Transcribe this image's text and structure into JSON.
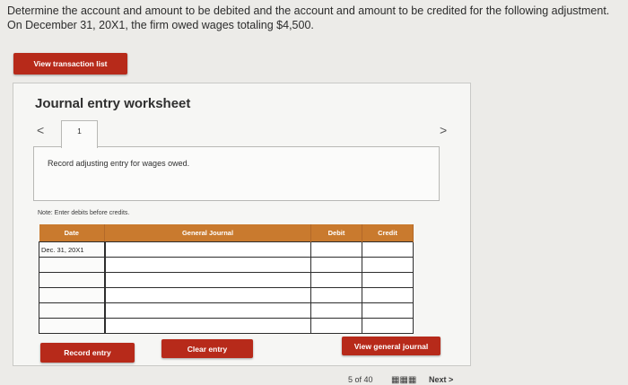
{
  "question": {
    "text": "Determine the account and amount to be debited and the account and amount to be credited for the following adjustment. On December 31, 20X1, the firm owed wages totaling $4,500."
  },
  "buttons": {
    "view_transaction_list": "View transaction list",
    "record_entry": "Record entry",
    "clear_entry": "Clear entry",
    "view_general_journal": "View general journal"
  },
  "worksheet": {
    "title": "Journal entry worksheet",
    "nav_prev": "<",
    "nav_next": ">",
    "current_tab": "1",
    "instruction": "Record adjusting entry for wages owed.",
    "note": "Note: Enter debits before credits."
  },
  "journal_table": {
    "headers": {
      "date": "Date",
      "general_journal": "General Journal",
      "debit": "Debit",
      "credit": "Credit"
    },
    "rows": [
      {
        "date": "Dec. 31, 20X1",
        "account": "",
        "debit": "",
        "credit": ""
      },
      {
        "date": "",
        "account": "",
        "debit": "",
        "credit": ""
      },
      {
        "date": "",
        "account": "",
        "debit": "",
        "credit": ""
      },
      {
        "date": "",
        "account": "",
        "debit": "",
        "credit": ""
      },
      {
        "date": "",
        "account": "",
        "debit": "",
        "credit": ""
      },
      {
        "date": "",
        "account": "",
        "debit": "",
        "credit": ""
      }
    ]
  },
  "footer": {
    "page_indicator": "5 of 40",
    "grid_icon": "grid-icon",
    "next_label": "Next >"
  },
  "colors": {
    "button_red": "#b72a1a",
    "header_orange": "#c97a2e",
    "background": "#ecebe8"
  }
}
